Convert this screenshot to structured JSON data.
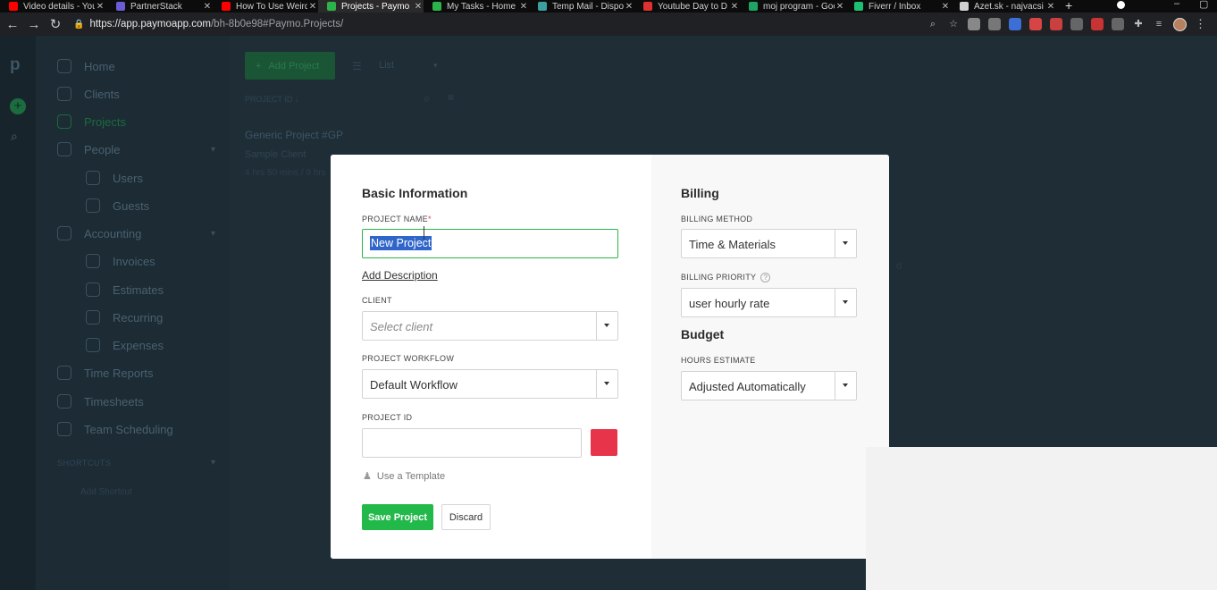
{
  "browser": {
    "tabs": [
      {
        "title": "Video details - You",
        "color": "#ff0000"
      },
      {
        "title": "PartnerStack",
        "color": "#6b5bd6"
      },
      {
        "title": "How To Use Weird",
        "color": "#ff0000"
      },
      {
        "title": "Projects - Paymo",
        "color": "#2cb34a",
        "active": true
      },
      {
        "title": "My Tasks - Home",
        "color": "#2cb34a"
      },
      {
        "title": "Temp Mail - Dispo",
        "color": "#3aa0a0"
      },
      {
        "title": "Youtube Day to D",
        "color": "#e03030"
      },
      {
        "title": "moj program - Goo",
        "color": "#1fa463"
      },
      {
        "title": "Fiverr / Inbox",
        "color": "#1dbf73"
      },
      {
        "title": "Azet.sk - najvacsi",
        "color": "#d0d0d0"
      }
    ],
    "url_host": "https://app.paymoapp.com",
    "url_path": "/bh-8b0e98#Paymo.Projects/"
  },
  "sidebar": {
    "items": [
      {
        "label": "Home"
      },
      {
        "label": "Clients"
      },
      {
        "label": "Projects"
      },
      {
        "label": "People"
      },
      {
        "label": "Users"
      },
      {
        "label": "Guests"
      },
      {
        "label": "Accounting"
      },
      {
        "label": "Invoices"
      },
      {
        "label": "Estimates"
      },
      {
        "label": "Recurring"
      },
      {
        "label": "Expenses"
      },
      {
        "label": "Time Reports"
      },
      {
        "label": "Timesheets"
      },
      {
        "label": "Team Scheduling"
      }
    ],
    "shortcuts_label": "SHORTCUTS",
    "add_shortcut": "Add Shortcut"
  },
  "main": {
    "add_project_label": "Add Project",
    "view_label": "List",
    "column_header": "PROJECT ID ↓",
    "project": {
      "title": "Generic Project #GP",
      "client": "Sample Client",
      "hours": "4 hrs 50 mins / 9 hrs"
    }
  },
  "modal": {
    "basic_title": "Basic Information",
    "project_name_label": "PROJECT NAME",
    "required_mark": "*",
    "project_name_value": "New Project",
    "add_description": "Add Description",
    "client_label": "CLIENT",
    "client_placeholder": "Select client",
    "workflow_label": "PROJECT WORKFLOW",
    "workflow_value": "Default Workflow",
    "project_id_label": "PROJECT ID",
    "project_id_value": "",
    "project_color": "#e8344a",
    "use_template": "Use a Template",
    "save_label": "Save Project",
    "discard_label": "Discard",
    "billing_title": "Billing",
    "billing_method_label": "BILLING METHOD",
    "billing_method_value": "Time & Materials",
    "billing_priority_label": "BILLING PRIORITY",
    "billing_priority_value": "user hourly rate",
    "budget_title": "Budget",
    "hours_estimate_label": "HOURS ESTIMATE",
    "hours_estimate_value": "Adjusted Automatically"
  },
  "colors": {
    "accent_green": "#23b84a",
    "sidebar_bg": "#1c2b34"
  }
}
